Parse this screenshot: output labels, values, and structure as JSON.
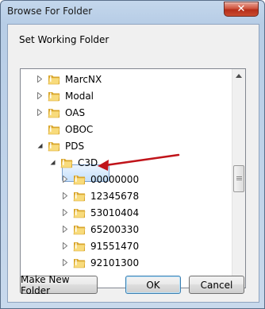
{
  "window": {
    "title": "Browse For Folder",
    "close_glyph": "✕",
    "prompt": "Set Working Folder"
  },
  "tree": {
    "items": [
      {
        "label": "MarcNX",
        "expander": "collapsed",
        "indent": 0
      },
      {
        "label": "Modal",
        "expander": "collapsed",
        "indent": 0
      },
      {
        "label": "OAS",
        "expander": "collapsed",
        "indent": 0
      },
      {
        "label": "OBOC",
        "expander": "none",
        "indent": 0
      },
      {
        "label": "PDS",
        "expander": "expanded",
        "indent": 0
      },
      {
        "label": "C3D",
        "expander": "expanded",
        "indent": 1,
        "selected": true
      },
      {
        "label": "00000000",
        "expander": "collapsed",
        "indent": 2
      },
      {
        "label": "12345678",
        "expander": "collapsed",
        "indent": 2
      },
      {
        "label": "53010404",
        "expander": "collapsed",
        "indent": 2
      },
      {
        "label": "65200330",
        "expander": "collapsed",
        "indent": 2
      },
      {
        "label": "91551470",
        "expander": "collapsed",
        "indent": 2
      },
      {
        "label": "92101300",
        "expander": "collapsed",
        "indent": 2
      }
    ]
  },
  "annotation": {
    "arrow_color": "#c0141a",
    "points_to": "C3D"
  },
  "buttons": {
    "make_new_folder": "Make New Folder",
    "ok": "OK",
    "cancel": "Cancel"
  },
  "colors": {
    "folder_light": "#f8db7c",
    "folder_dark": "#d9a62c",
    "selection_border": "#7da2ce"
  }
}
